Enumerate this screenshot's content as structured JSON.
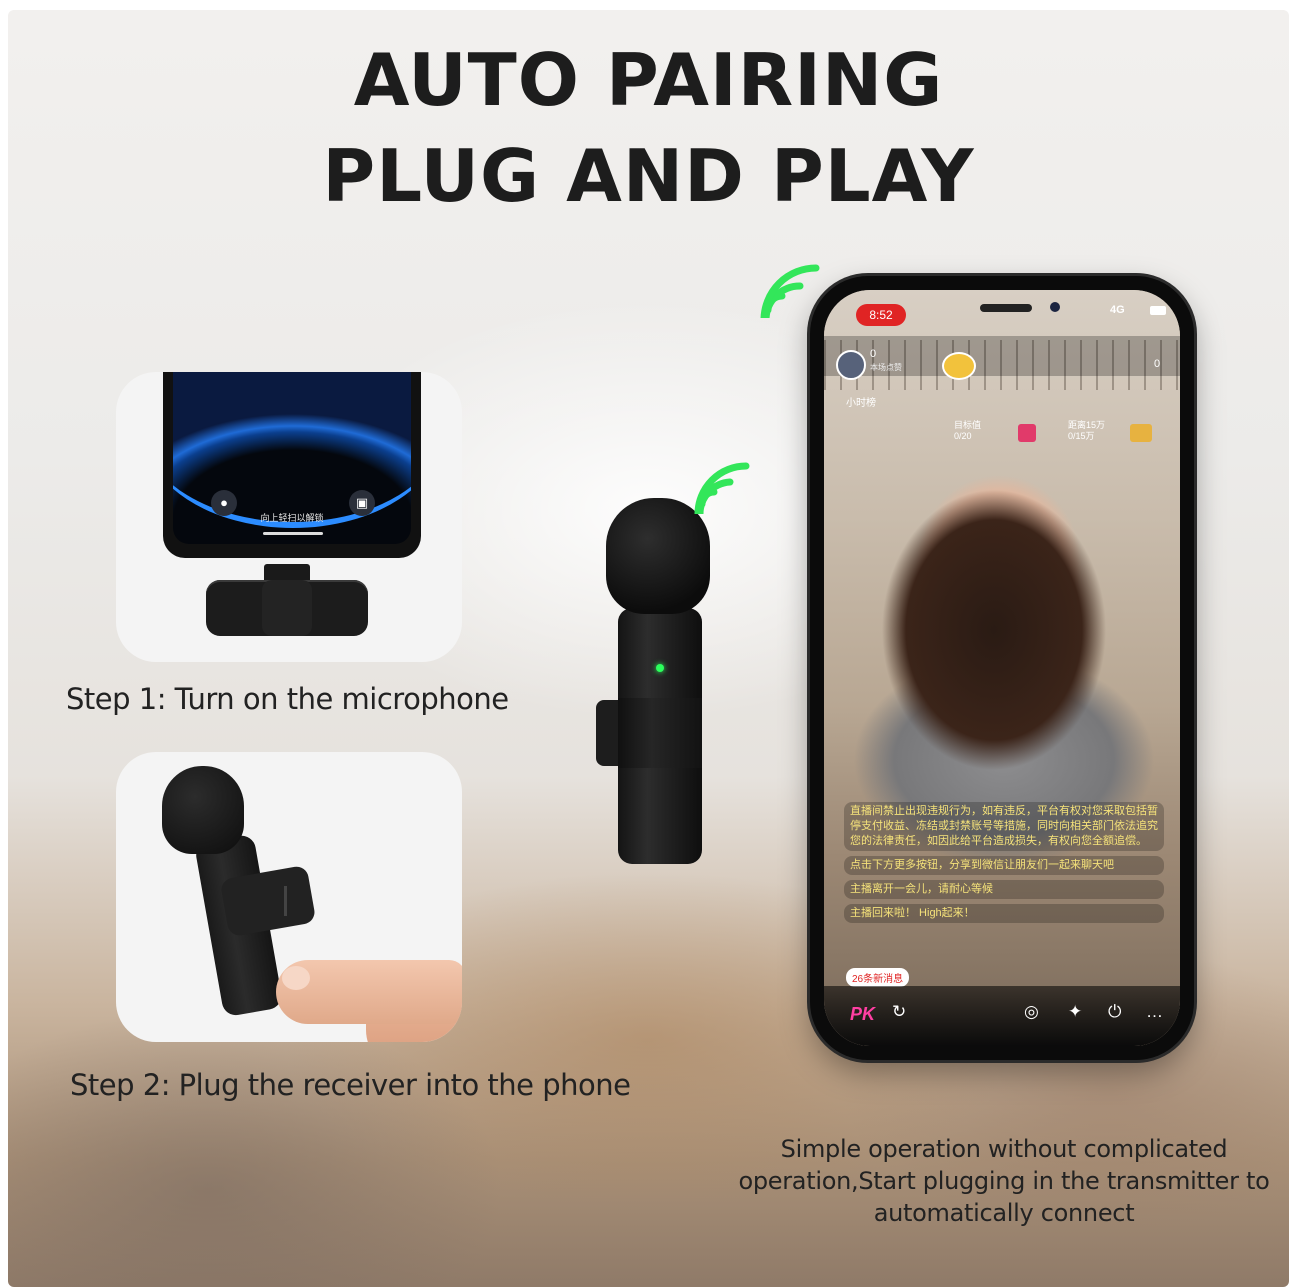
{
  "headline": {
    "line1": "AUTO PAIRING",
    "line2": "PLUG AND PLAY"
  },
  "steps": [
    {
      "caption": "Step 1: Turn on the microphone"
    },
    {
      "caption": "Step 2: Plug the receiver into the phone"
    }
  ],
  "mini_phone": {
    "lock_hint": "向上轻扫以解锁",
    "left_icon": "flashlight-icon",
    "right_icon": "camera-icon"
  },
  "description": "Simple operation without complicated operation,Start plugging in the transmitter to automatically connect",
  "phone_screen": {
    "time": "8:52",
    "network": "4G",
    "viewer_count": "0",
    "host_label": "本场点赞",
    "right_count": "0",
    "hour_rank": "小时榜",
    "task1_label": "目标值",
    "task1_value": "0/20",
    "task2_label": "距离15万",
    "task2_value": "0/15万",
    "chat_messages": [
      "直播间禁止出现违规行为，如有违反，平台有权对您采取包括暂停支付收益、冻结或封禁账号等措施，同时向相关部门依法追究您的法律责任，如因此给平台造成损失，有权向您全额追偿。",
      "点击下方更多按钮，分享到微信让朋友们一起来聊天吧",
      "主播离开一会儿，请耐心等候",
      "主播回来啦！ High起来！"
    ],
    "new_messages": "26条新消息",
    "bottom_pk": "PK"
  },
  "colors": {
    "wifi_green": "#33e65a",
    "title_color": "#1d1d1d",
    "led_green": "#2bff5c"
  }
}
